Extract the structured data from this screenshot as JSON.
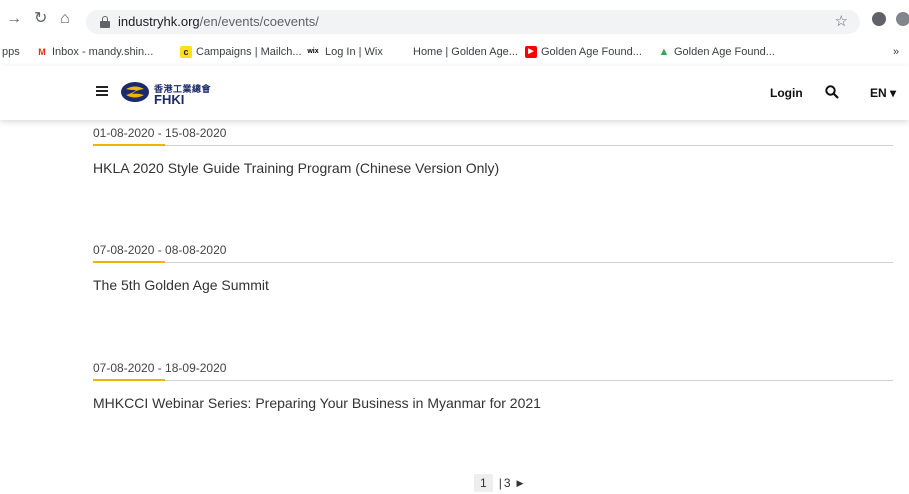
{
  "browser": {
    "url_host": "industryhk.org",
    "url_path": "/en/events/coevents/"
  },
  "bookmarks": [
    {
      "label": "pps"
    },
    {
      "label": "Inbox - mandy.shin..."
    },
    {
      "label": "Campaigns | Mailch..."
    },
    {
      "label": "Log In | Wix"
    },
    {
      "label": "Home | Golden Age..."
    },
    {
      "label": "Golden Age Found..."
    },
    {
      "label": "Golden Age Found..."
    },
    {
      "label": "»"
    }
  ],
  "header": {
    "logo_cn": "香港工業總會",
    "logo_en": "FHKI",
    "login_label": "Login",
    "lang_label": "EN ▾"
  },
  "events": [
    {
      "date": "01-08-2020 - 15-08-2020",
      "title": "HKLA 2020 Style Guide Training Program (Chinese Version Only)"
    },
    {
      "date": "07-08-2020 - 08-08-2020",
      "title": "The 5th Golden Age Summit"
    },
    {
      "date": "07-08-2020 - 18-09-2020",
      "title": "MHKCCI Webinar Series: Preparing Your Business in Myanmar for 2021"
    }
  ],
  "pagination": {
    "current": "1",
    "separator": "|",
    "last": "3",
    "next": "▶"
  },
  "colors": {
    "accent": "#f0b400",
    "brand": "#1a2a6c"
  }
}
